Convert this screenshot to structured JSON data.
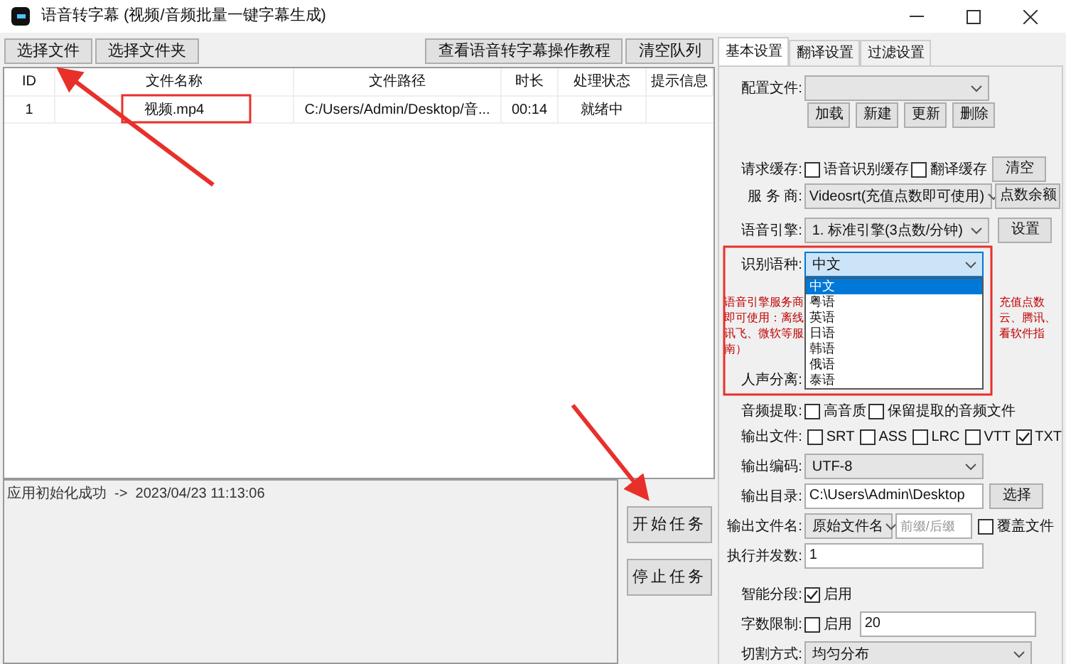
{
  "window": {
    "title": "语音转字幕 (视频/音频批量一键字幕生成)"
  },
  "toolbar": {
    "left": [
      "选择文件",
      "选择文件夹"
    ],
    "right": [
      "查看语音转字幕操作教程",
      "清空队列"
    ]
  },
  "table": {
    "columns": [
      "ID",
      "文件名称",
      "文件路径",
      "时长",
      "处理状态",
      "提示信息"
    ],
    "rows": [
      {
        "id": "1",
        "file_name": "视频.mp4",
        "path": "C:/Users/Admin/Desktop/音...",
        "duration": "00:14",
        "status": "就绪中"
      }
    ]
  },
  "log": [
    "应用初始化成功  ->  2023/04/23 11:13:06"
  ],
  "actions": [
    "开始任务",
    "停止任务"
  ],
  "settings": {
    "tabs": [
      {
        "label": "基本设置",
        "selected": true
      },
      {
        "label": "翻译设置",
        "selected": false
      },
      {
        "label": "过滤设置",
        "selected": false
      }
    ],
    "config_file": {
      "label": "配置文件:",
      "buttons": [
        "加载",
        "新建",
        "更新",
        "删除"
      ]
    },
    "request_cache": {
      "label": "请求缓存:",
      "options": [
        {
          "label": "语音识别缓存",
          "checked": false
        },
        {
          "label": "翻译缓存",
          "checked": false
        }
      ],
      "button": "清空"
    },
    "provider": {
      "label": "服 务 商:",
      "value": "Videosrt(充值点数即可使用)",
      "button": "点数余额"
    },
    "engine": {
      "label": "语音引擎:",
      "value": "1. 标准引擎(3点数/分钟)",
      "button": "设置"
    },
    "language": {
      "label": "识别语种:",
      "value": "中文",
      "expanded": true,
      "options": [
        {
          "label": "中文",
          "selected": true
        },
        {
          "label": "粤语",
          "selected": false
        },
        {
          "label": "英语",
          "selected": false
        },
        {
          "label": "日语",
          "selected": false
        },
        {
          "label": "韩语",
          "selected": false
        },
        {
          "label": "俄语",
          "selected": false
        },
        {
          "label": "泰语",
          "selected": false
        }
      ]
    },
    "notice": {
      "left": [
        "语音引擎服务商",
        "即可使用：离线",
        "讯飞、微软等服",
        "南）"
      ],
      "right": [
        "充值点数",
        "云、腾讯、",
        "看软件指"
      ]
    },
    "voice_separation": {
      "label": "人声分离:"
    },
    "audio_extract": {
      "label": "音频提取:",
      "options": [
        {
          "label": "高音质",
          "checked": false
        },
        {
          "label": "保留提取的音频文件",
          "checked": false
        }
      ]
    },
    "output_formats": {
      "label": "输出文件:",
      "options": [
        {
          "label": "SRT",
          "checked": false
        },
        {
          "label": "ASS",
          "checked": false
        },
        {
          "label": "LRC",
          "checked": false
        },
        {
          "label": "VTT",
          "checked": false
        },
        {
          "label": "TXT",
          "checked": true
        }
      ]
    },
    "output_encoding": {
      "label": "输出编码:",
      "value": "UTF-8"
    },
    "output_dir": {
      "label": "输出目录:",
      "value": "C:\\Users\\Admin\\Desktop",
      "button": "选择"
    },
    "output_name": {
      "label": "输出文件名:",
      "value": "原始文件名",
      "placeholder": "前缀/后缀",
      "overwrite": {
        "label": "覆盖文件",
        "checked": false
      }
    },
    "concurrency": {
      "label": "执行并发数:",
      "value": "1"
    },
    "smart_segment": {
      "label": "智能分段:",
      "option": {
        "label": "启用",
        "checked": true
      }
    },
    "char_limit": {
      "label": "字数限制:",
      "option": {
        "label": "启用",
        "checked": false
      },
      "value": "20"
    },
    "split_mode": {
      "label": "切割方式:",
      "value": "均匀分布"
    }
  }
}
